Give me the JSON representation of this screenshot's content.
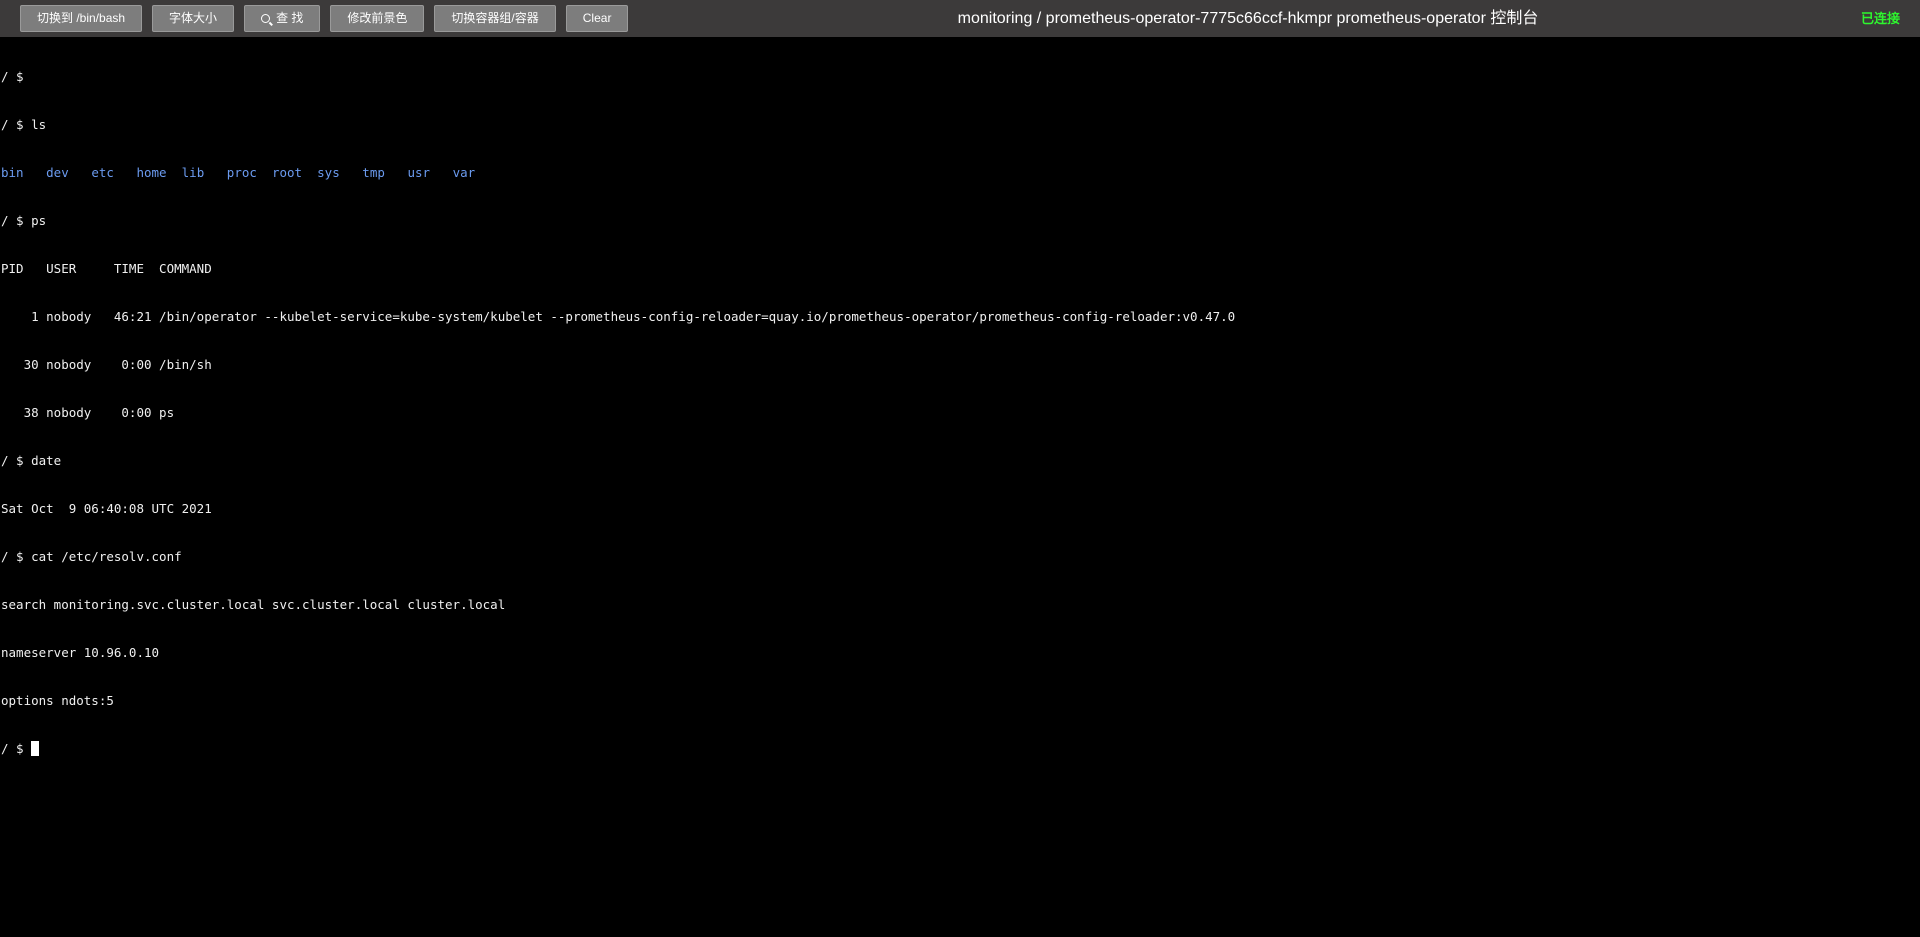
{
  "toolbar": {
    "buttons": [
      {
        "label": "切换到 /bin/bash"
      },
      {
        "label": "字体大小"
      },
      {
        "label": "查 找"
      },
      {
        "label": "修改前景色"
      },
      {
        "label": "切换容器组/容器"
      },
      {
        "label": "Clear"
      }
    ]
  },
  "title": "monitoring / prometheus-operator-7775c66ccf-hkmpr prometheus-operator 控制台",
  "status": "已连接",
  "colors": {
    "topbar_bg": "#3c3a3a",
    "button_bg": "#7d7d7d",
    "status_green": "#2ef52e",
    "terminal_bg": "#000000",
    "terminal_fg": "#f0f0f0",
    "ls_dir_color": "#6b9bf0"
  },
  "terminal": {
    "lines": [
      "/ $",
      "/ $ ls",
      "",
      "/ $ ps",
      "PID   USER     TIME  COMMAND",
      "    1 nobody   46:21 /bin/operator --kubelet-service=kube-system/kubelet --prometheus-config-reloader=quay.io/prometheus-operator/prometheus-config-reloader:v0.47.0",
      "   30 nobody    0:00 /bin/sh",
      "   38 nobody    0:00 ps",
      "/ $ date",
      "Sat Oct  9 06:40:08 UTC 2021",
      "/ $ cat /etc/resolv.conf",
      "search monitoring.svc.cluster.local svc.cluster.local cluster.local",
      "nameserver 10.96.0.10",
      "options ndots:5",
      "/ $ "
    ],
    "ls_entries": [
      "bin",
      "dev",
      "etc",
      "home",
      "lib",
      "proc",
      "root",
      "sys",
      "tmp",
      "usr",
      "var"
    ]
  }
}
